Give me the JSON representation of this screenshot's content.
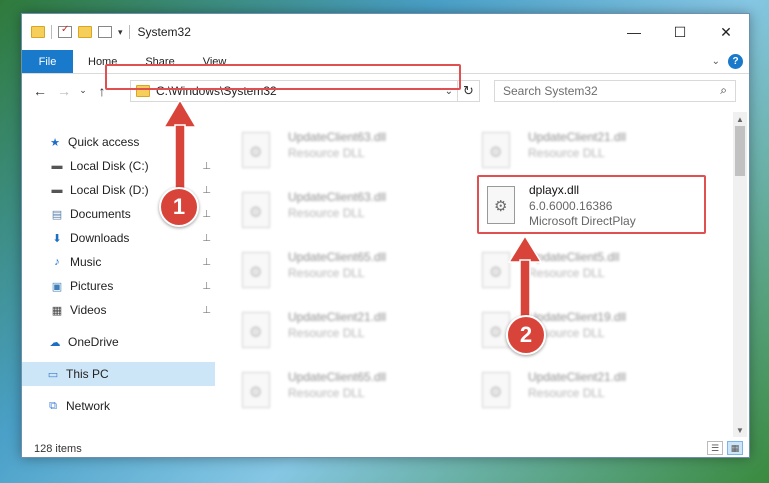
{
  "window": {
    "title": "System32"
  },
  "titlebar": {
    "minimize": "—",
    "maximize": "☐",
    "close": "✕",
    "dropdown": "▾"
  },
  "ribbon": {
    "tabs": [
      "File",
      "Home",
      "Share",
      "View"
    ],
    "collapse": "⌄",
    "help": "?"
  },
  "nav": {
    "back": "←",
    "forward": "→",
    "recent": "⌄",
    "up": "↑",
    "address": "C:\\Windows\\System32",
    "address_dropdown": "⌄",
    "refresh": "↻",
    "search_placeholder": "Search System32",
    "search_icon": "⌕"
  },
  "sidebar": {
    "items": [
      {
        "label": "Quick access",
        "icon": "star-icon",
        "glyph": "★",
        "color": "#1e6fc4",
        "pinned": false
      },
      {
        "label": "Local Disk (C:)",
        "icon": "drive-icon",
        "glyph": "▬",
        "color": "#555555",
        "pinned": true
      },
      {
        "label": "Local Disk (D:)",
        "icon": "drive-icon",
        "glyph": "▬",
        "color": "#555555",
        "pinned": true
      },
      {
        "label": "Documents",
        "icon": "documents-icon",
        "glyph": "▤",
        "color": "#5a7fa8",
        "pinned": true
      },
      {
        "label": "Downloads",
        "icon": "download-icon",
        "glyph": "⬇",
        "color": "#1e6fc4",
        "pinned": true
      },
      {
        "label": "Music",
        "icon": "music-icon",
        "glyph": "♪",
        "color": "#1e6fc4",
        "pinned": true
      },
      {
        "label": "Pictures",
        "icon": "pictures-icon",
        "glyph": "▣",
        "color": "#3f7fb8",
        "pinned": true
      },
      {
        "label": "Videos",
        "icon": "videos-icon",
        "glyph": "▦",
        "color": "#444444",
        "pinned": true
      },
      {
        "label": "OneDrive",
        "icon": "cloud-icon",
        "glyph": "☁",
        "color": "#1e6fc4",
        "pinned": false
      },
      {
        "label": "This PC",
        "icon": "computer-icon",
        "glyph": "▭",
        "color": "#3a7bd5",
        "pinned": false,
        "selected": true
      },
      {
        "label": "Network",
        "icon": "network-icon",
        "glyph": "⧉",
        "color": "#3a7bd5",
        "pinned": false
      }
    ],
    "pin_glyph": "📌"
  },
  "files": {
    "left_column": [
      {
        "name": "UpdateClient63.dll",
        "desc": "Resource DLL"
      },
      {
        "name": "UpdateClient63.dll",
        "desc": "Resource DLL"
      },
      {
        "name": "UpdateClient65.dll",
        "desc": "Resource DLL"
      },
      {
        "name": "UpdateClient21.dll",
        "desc": "Resource DLL"
      },
      {
        "name": "UpdateClient65.dll",
        "desc": "Resource DLL"
      }
    ],
    "right_column": [
      {
        "name": "UpdateClient21.dll",
        "desc": "Resource DLL"
      },
      {
        "name": "UpdateClient5.dll",
        "desc": "Resource DLL"
      },
      {
        "name": "UpdateClient19.dll",
        "desc": "Resource DLL"
      },
      {
        "name": "UpdateClient21.dll",
        "desc": "Resource DLL"
      }
    ],
    "target": {
      "name": "dplayx.dll",
      "version": "6.0.6000.16386",
      "desc": "Microsoft DirectPlay"
    }
  },
  "status": {
    "count": "128 items"
  },
  "annotations": {
    "badge1": "1",
    "badge2": "2",
    "color": "#d9443a"
  }
}
